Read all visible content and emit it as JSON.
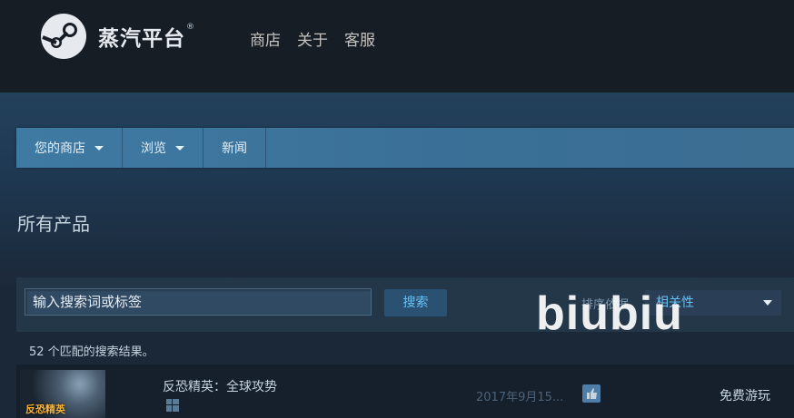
{
  "header": {
    "logo_text": "蒸汽平台",
    "logo_tm": "®",
    "nav": [
      "商店",
      "关于",
      "客服"
    ]
  },
  "store_nav": {
    "tabs": [
      {
        "label": "您的商店",
        "dropdown": true
      },
      {
        "label": "浏览",
        "dropdown": true
      },
      {
        "label": "新闻",
        "dropdown": false
      }
    ]
  },
  "page": {
    "title": "所有产品"
  },
  "search": {
    "input_value": "输入搜索词或标签",
    "button_label": "搜索",
    "sort_label": "排序依据",
    "sort_value": "相关性"
  },
  "results": {
    "count_text": "52 个匹配的搜索结果。",
    "items": [
      {
        "capsule_text": "反恐精英",
        "title": "反恐精英：全球攻势",
        "platform_icon": "windows-icon",
        "release_date": "2017年9月15...",
        "review_icon": "thumbs-up-icon",
        "price": "免费游玩"
      }
    ]
  },
  "watermark": "biubiu",
  "colors": {
    "header_bg": "#171d25",
    "nav_bar": "#3f7aa3",
    "accent_link": "#67c1f5",
    "panel_bg": "#243749"
  }
}
